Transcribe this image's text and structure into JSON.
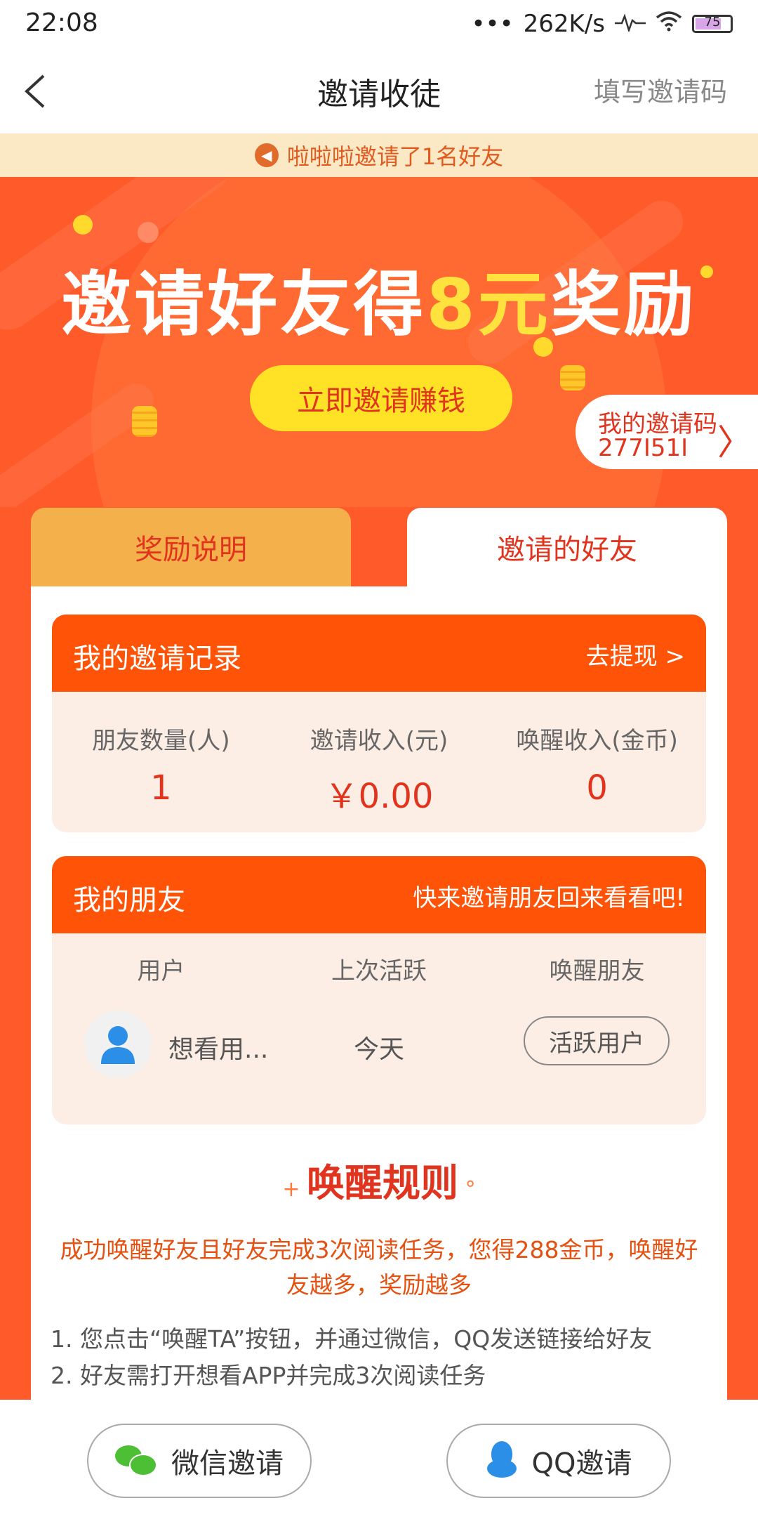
{
  "status_bar": {
    "time": "22:08",
    "signal": "•••",
    "speed": "262K/s",
    "battery": "75"
  },
  "nav": {
    "title": "邀请收徒",
    "right": "填写邀请码"
  },
  "ticker": {
    "text": "啦啦啦邀请了1名好友"
  },
  "hero": {
    "title_prefix": "邀请好友得",
    "title_highlight": "8元",
    "title_suffix": "奖励",
    "cta": "立即邀请赚钱",
    "invite_code_label": "我的邀请码",
    "invite_code": "277I51I",
    "chevron": "〉"
  },
  "tabs": {
    "rules": "奖励说明",
    "friends": "邀请的好友"
  },
  "records": {
    "title": "我的邀请记录",
    "withdraw": "去提现 >",
    "stats": [
      {
        "label": "朋友数量(人)",
        "value": "1"
      },
      {
        "label": "邀请收入(元)",
        "value": "￥0.00"
      },
      {
        "label": "唤醒收入(金币)",
        "value": "0"
      }
    ]
  },
  "friends": {
    "title": "我的朋友",
    "hint": "快来邀请朋友回来看看吧!",
    "col_user": "用户",
    "col_active": "上次活跃",
    "col_wake": "唤醒朋友",
    "rows": [
      {
        "name": "想看用...",
        "last_active": "今天",
        "button": "活跃用户"
      }
    ]
  },
  "rules": {
    "title": "唤醒规则",
    "desc": "成功唤醒好友且好友完成3次阅读任务，您得288金币，唤醒好友越多，奖励越多",
    "items": [
      "1. 您点击“唤醒TA”按钮，并通过微信，QQ发送链接给好友",
      "2. 好友需打开想看APP并完成3次阅读任务"
    ]
  },
  "bottom": {
    "wechat": "微信邀请",
    "qq": "QQ邀请"
  }
}
